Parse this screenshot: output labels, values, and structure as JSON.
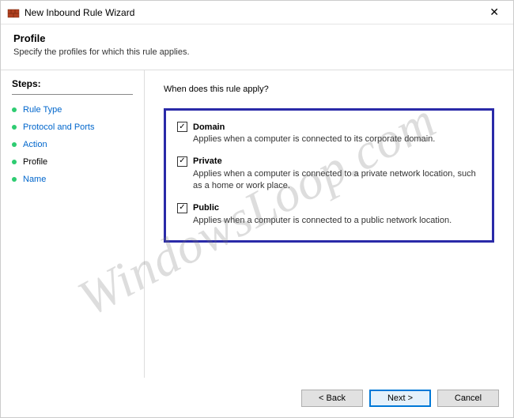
{
  "window": {
    "title": "New Inbound Rule Wizard",
    "close_glyph": "✕"
  },
  "header": {
    "title": "Profile",
    "description": "Specify the profiles for which this rule applies."
  },
  "sidebar": {
    "steps_label": "Steps:",
    "items": [
      {
        "label": "Rule Type",
        "current": false
      },
      {
        "label": "Protocol and Ports",
        "current": false
      },
      {
        "label": "Action",
        "current": false
      },
      {
        "label": "Profile",
        "current": true
      },
      {
        "label": "Name",
        "current": false
      }
    ]
  },
  "content": {
    "question": "When does this rule apply?",
    "profiles": [
      {
        "name": "Domain",
        "checked": true,
        "desc": "Applies when a computer is connected to its corporate domain."
      },
      {
        "name": "Private",
        "checked": true,
        "desc": "Applies when a computer is connected to a private network location, such as a home or work place."
      },
      {
        "name": "Public",
        "checked": true,
        "desc": "Applies when a computer is connected to a public network location."
      }
    ],
    "check_glyph": "✓"
  },
  "footer": {
    "back": "< Back",
    "next": "Next >",
    "cancel": "Cancel"
  },
  "watermark": "WindowsLoop.com"
}
